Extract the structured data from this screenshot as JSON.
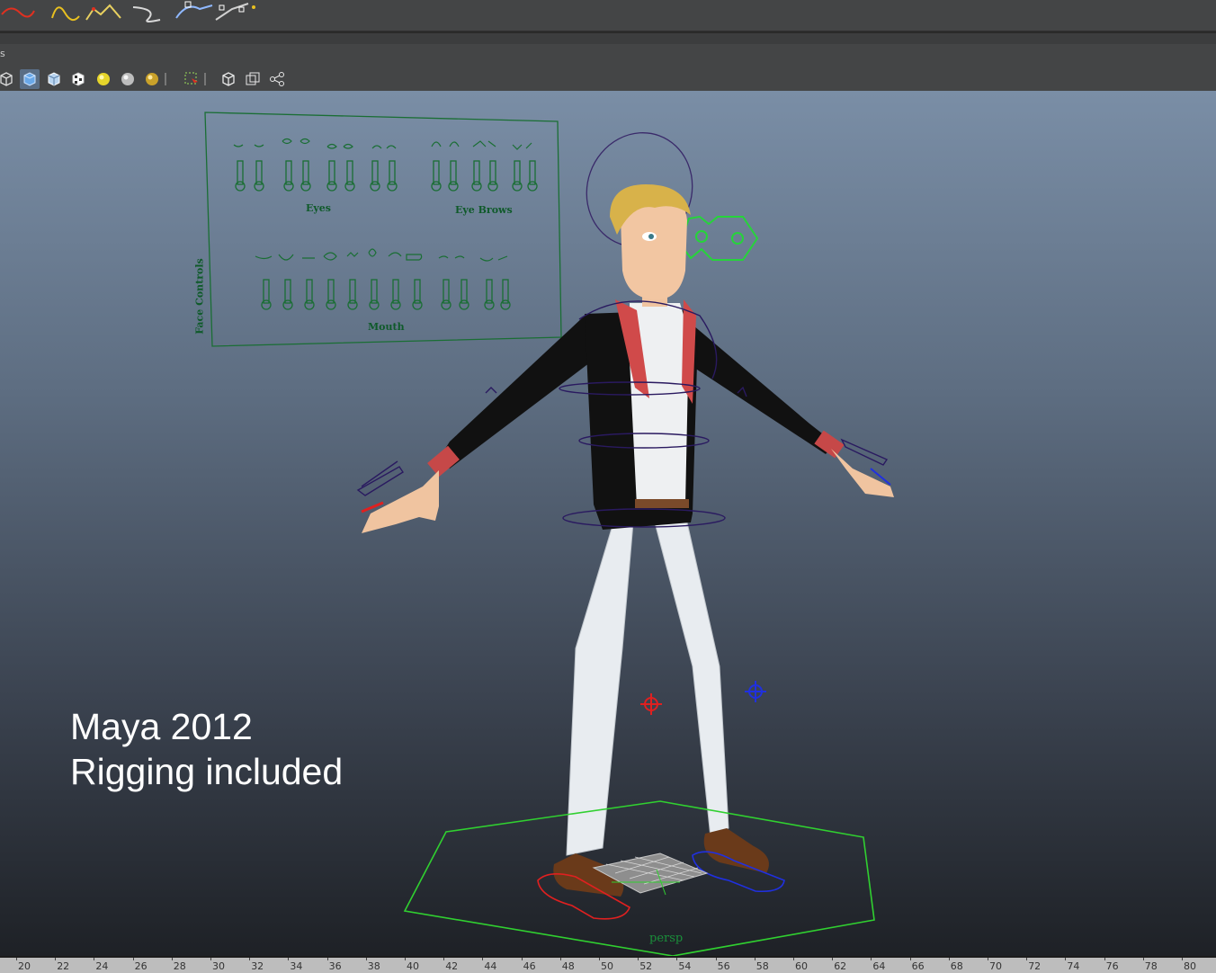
{
  "panel_label": "s",
  "shelf_icons": [
    "ep-curve-tool-icon",
    "bezier-curve-icon",
    "pencil-curve-icon",
    "arc-tool-icon",
    "circle-nurbs-icon",
    "square-nurbs-icon",
    "curve-edit-icon"
  ],
  "viewport_toolbar": [
    "wireframe-shading-icon",
    "smooth-shading-icon",
    "flat-shading-icon",
    "textured-icon",
    "use-all-lights-icon",
    "default-light-icon",
    "shadows-icon",
    "select-camera-icon",
    "isolate-select-icon",
    "xray-icon",
    "joints-xray-icon"
  ],
  "face_controls": {
    "title": "Face Controls",
    "groups": {
      "eyes": "Eyes",
      "eye_brows": "Eye Brows",
      "mouth": "Mouth"
    }
  },
  "overlay": {
    "line1": "Maya 2012",
    "line2": "Rigging included"
  },
  "camera_label": "persp",
  "timeline_ticks": [
    "20",
    "22",
    "24",
    "26",
    "28",
    "30",
    "32",
    "34",
    "36",
    "38",
    "40",
    "42",
    "44",
    "46",
    "48",
    "50",
    "52",
    "54",
    "56",
    "58",
    "60",
    "62",
    "64",
    "66",
    "68",
    "70",
    "72",
    "74",
    "76",
    "78",
    "80"
  ]
}
